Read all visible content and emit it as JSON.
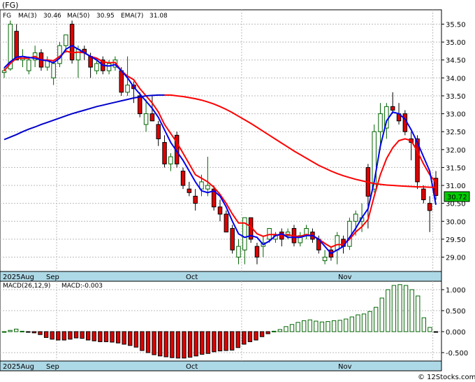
{
  "chart_data": [
    {
      "type": "candlestick",
      "title": "(FG)",
      "legend": {
        "ticker": "FG",
        "ma3": "MA(3)",
        "ma3_value": "30.46",
        "ma50": "MA(50)",
        "ma50_value": "30.95",
        "ema7": "EMA(7)",
        "ema7_value": "31.08"
      },
      "colors": {
        "up": "#006400",
        "down": "#e00000",
        "ma3": "#0000ee",
        "ma50": "#0000cc",
        "ema7": "#ff0000",
        "last_price_box": "#00cc00"
      },
      "ylim": [
        28.6,
        35.9
      ],
      "yticks": [
        "35.50",
        "35.00",
        "34.50",
        "34.00",
        "33.50",
        "33.00",
        "32.50",
        "32.00",
        "31.50",
        "31.00",
        "30.50",
        "30.00",
        "29.50",
        "29.00"
      ],
      "last_price": "30.72",
      "date_labels": [
        "2025Aug",
        "Sep",
        "Oct",
        "Nov"
      ],
      "candles": [
        [
          34.15,
          34.3,
          34.0,
          34.2
        ],
        [
          34.25,
          35.6,
          34.2,
          35.5
        ],
        [
          35.3,
          35.5,
          34.5,
          34.5
        ],
        [
          34.5,
          34.8,
          34.3,
          34.6
        ],
        [
          34.2,
          34.6,
          34.1,
          34.5
        ],
        [
          34.5,
          34.9,
          34.3,
          34.7
        ],
        [
          34.7,
          34.8,
          34.2,
          34.3
        ],
        [
          34.3,
          34.6,
          34.2,
          34.5
        ],
        [
          34.0,
          34.5,
          33.8,
          34.4
        ],
        [
          34.4,
          35.0,
          34.3,
          34.9
        ],
        [
          34.9,
          35.2,
          34.7,
          35.2
        ],
        [
          35.5,
          35.6,
          34.4,
          34.5
        ],
        [
          34.5,
          34.9,
          34.0,
          34.8
        ],
        [
          34.8,
          34.9,
          34.5,
          34.7
        ],
        [
          34.6,
          34.7,
          34.0,
          34.3
        ],
        [
          34.2,
          34.5,
          34.1,
          34.4
        ],
        [
          34.5,
          34.6,
          34.1,
          34.2
        ],
        [
          34.2,
          34.5,
          34.1,
          34.4
        ],
        [
          34.3,
          34.6,
          34.2,
          34.5
        ],
        [
          34.2,
          34.3,
          33.5,
          33.6
        ],
        [
          33.6,
          34.6,
          33.5,
          33.8
        ],
        [
          33.8,
          33.9,
          33.3,
          33.7
        ],
        [
          33.5,
          33.6,
          32.9,
          33.0
        ],
        [
          32.7,
          33.4,
          32.5,
          33.0
        ],
        [
          33.0,
          33.5,
          32.8,
          32.8
        ],
        [
          32.7,
          32.8,
          32.1,
          32.3
        ],
        [
          32.2,
          32.4,
          31.5,
          31.6
        ],
        [
          31.6,
          31.9,
          31.4,
          31.8
        ],
        [
          32.4,
          32.5,
          31.5,
          31.6
        ],
        [
          31.4,
          31.5,
          30.9,
          31.0
        ],
        [
          30.9,
          31.1,
          30.7,
          30.8
        ],
        [
          30.7,
          30.9,
          30.3,
          30.5
        ],
        [
          30.9,
          31.3,
          30.7,
          31.1
        ],
        [
          30.9,
          31.8,
          30.7,
          31.0
        ],
        [
          30.9,
          31.0,
          30.3,
          30.4
        ],
        [
          30.4,
          30.6,
          30.0,
          30.2
        ],
        [
          30.2,
          30.3,
          29.7,
          29.7
        ],
        [
          29.8,
          29.9,
          29.1,
          29.2
        ],
        [
          29.0,
          29.5,
          28.8,
          29.3
        ],
        [
          29.2,
          30.1,
          28.8,
          30.1
        ],
        [
          30.1,
          30.1,
          29.4,
          29.5
        ],
        [
          29.3,
          29.4,
          28.8,
          29.0
        ],
        [
          29.3,
          29.6,
          29.0,
          29.4
        ],
        [
          29.5,
          29.8,
          29.4,
          29.8
        ],
        [
          29.5,
          29.7,
          29.4,
          29.6
        ],
        [
          29.7,
          29.8,
          29.3,
          29.5
        ],
        [
          29.6,
          29.8,
          29.5,
          29.7
        ],
        [
          29.8,
          29.9,
          29.3,
          29.4
        ],
        [
          29.4,
          29.7,
          29.3,
          29.6
        ],
        [
          29.6,
          29.9,
          29.5,
          29.8
        ],
        [
          29.7,
          29.8,
          29.4,
          29.5
        ],
        [
          29.5,
          29.6,
          29.1,
          29.2
        ],
        [
          28.9,
          29.2,
          28.8,
          29.0
        ],
        [
          29.2,
          29.3,
          28.9,
          29.0
        ],
        [
          29.2,
          29.7,
          28.8,
          29.6
        ],
        [
          29.5,
          29.6,
          29.1,
          29.3
        ],
        [
          29.3,
          30.1,
          29.2,
          30.0
        ],
        [
          30.0,
          30.3,
          29.6,
          30.2
        ],
        [
          30.0,
          30.5,
          29.7,
          30.1
        ],
        [
          31.5,
          31.6,
          29.8,
          30.7
        ],
        [
          30.9,
          32.7,
          30.8,
          32.5
        ],
        [
          32.5,
          33.3,
          32.0,
          33.0
        ],
        [
          32.6,
          33.3,
          32.3,
          33.2
        ],
        [
          33.2,
          33.6,
          33.0,
          33.1
        ],
        [
          33.0,
          33.3,
          32.7,
          32.8
        ],
        [
          33.0,
          33.1,
          32.4,
          32.5
        ],
        [
          32.3,
          32.5,
          31.7,
          32.2
        ],
        [
          32.3,
          32.4,
          30.9,
          31.1
        ],
        [
          30.9,
          31.0,
          30.5,
          30.6
        ],
        [
          30.5,
          30.7,
          29.7,
          30.3
        ],
        [
          31.2,
          31.4,
          30.6,
          30.72
        ]
      ],
      "ma3": [
        34.28,
        34.45,
        34.58,
        34.6,
        34.57,
        34.55,
        34.5,
        34.48,
        34.42,
        34.55,
        34.8,
        34.9,
        34.8,
        34.7,
        34.6,
        34.5,
        34.35,
        34.33,
        34.37,
        34.2,
        34.0,
        33.75,
        33.55,
        33.35,
        33.15,
        32.9,
        32.55,
        32.2,
        31.95,
        31.7,
        31.4,
        31.1,
        30.85,
        30.8,
        30.85,
        30.7,
        30.4,
        30.0,
        29.65,
        29.55,
        29.6,
        29.55,
        29.35,
        29.45,
        29.6,
        29.65,
        29.55,
        29.55,
        29.55,
        29.6,
        29.6,
        29.5,
        29.3,
        29.1,
        29.2,
        29.3,
        29.55,
        29.8,
        30.1,
        30.35,
        31.1,
        32.1,
        32.8,
        33.05,
        33.0,
        32.85,
        32.55,
        32.2,
        31.8,
        31.4,
        30.46
      ],
      "ema7": [
        34.2,
        34.4,
        34.55,
        34.55,
        34.55,
        34.6,
        34.5,
        34.5,
        34.48,
        34.6,
        34.75,
        34.7,
        34.72,
        34.7,
        34.6,
        34.55,
        34.45,
        34.42,
        34.43,
        34.2,
        34.05,
        33.95,
        33.7,
        33.5,
        33.3,
        33.05,
        32.7,
        32.45,
        32.2,
        31.9,
        31.6,
        31.3,
        31.2,
        31.1,
        30.95,
        30.75,
        30.5,
        30.2,
        29.95,
        29.95,
        29.85,
        29.65,
        29.58,
        29.63,
        29.63,
        29.6,
        29.63,
        29.58,
        29.58,
        29.63,
        29.6,
        29.5,
        29.38,
        29.28,
        29.35,
        29.35,
        29.5,
        29.7,
        29.85,
        30.05,
        30.7,
        31.3,
        31.75,
        32.05,
        32.25,
        32.3,
        32.25,
        31.95,
        31.6,
        31.3,
        31.08
      ],
      "ma50": [
        32.28,
        32.35,
        32.42,
        32.5,
        32.57,
        32.63,
        32.7,
        32.76,
        32.82,
        32.88,
        32.94,
        33.0,
        33.05,
        33.1,
        33.15,
        33.2,
        33.24,
        33.28,
        33.32,
        33.36,
        33.4,
        33.44,
        33.47,
        33.5,
        33.51,
        33.52,
        33.52,
        33.52,
        33.5,
        33.48,
        33.45,
        33.42,
        33.38,
        33.33,
        33.27,
        33.2,
        33.12,
        33.03,
        32.93,
        32.83,
        32.73,
        32.62,
        32.51,
        32.4,
        32.29,
        32.18,
        32.07,
        31.96,
        31.86,
        31.76,
        31.66,
        31.56,
        31.48,
        31.4,
        31.33,
        31.27,
        31.22,
        31.17,
        31.13,
        31.09,
        31.05,
        31.03,
        31.01,
        31.0,
        30.99,
        30.98,
        30.97,
        30.96,
        30.96,
        30.95,
        30.95
      ]
    },
    {
      "type": "bar",
      "title": "MACD(26,12,9)",
      "value_label": "MACD:-0.003",
      "ylim": [
        -0.7,
        1.2
      ],
      "yticks": [
        "1.000",
        "0.500",
        "0.000",
        "-0.500"
      ],
      "date_labels": [
        "2025Aug",
        "Sep",
        "Oct",
        "Nov"
      ],
      "values": [
        0.0,
        0.03,
        0.06,
        0.01,
        -0.01,
        -0.03,
        -0.07,
        -0.14,
        -0.18,
        -0.2,
        -0.2,
        -0.18,
        -0.15,
        -0.16,
        -0.2,
        -0.22,
        -0.24,
        -0.24,
        -0.25,
        -0.27,
        -0.3,
        -0.33,
        -0.37,
        -0.45,
        -0.5,
        -0.55,
        -0.58,
        -0.6,
        -0.62,
        -0.63,
        -0.63,
        -0.61,
        -0.58,
        -0.54,
        -0.52,
        -0.48,
        -0.46,
        -0.45,
        -0.44,
        -0.38,
        -0.3,
        -0.24,
        -0.2,
        -0.12,
        -0.05,
        0.01,
        0.05,
        0.12,
        0.17,
        0.22,
        0.26,
        0.28,
        0.25,
        0.23,
        0.24,
        0.26,
        0.27,
        0.3,
        0.35,
        0.4,
        0.42,
        0.48,
        0.58,
        0.8,
        1.0,
        1.1,
        1.12,
        1.1,
        1.0,
        0.85,
        0.33,
        0.1,
        -0.003
      ],
      "colors": {
        "up": "#006400",
        "down": "#e00000"
      }
    }
  ],
  "watermark": "© 12Stocks.com"
}
